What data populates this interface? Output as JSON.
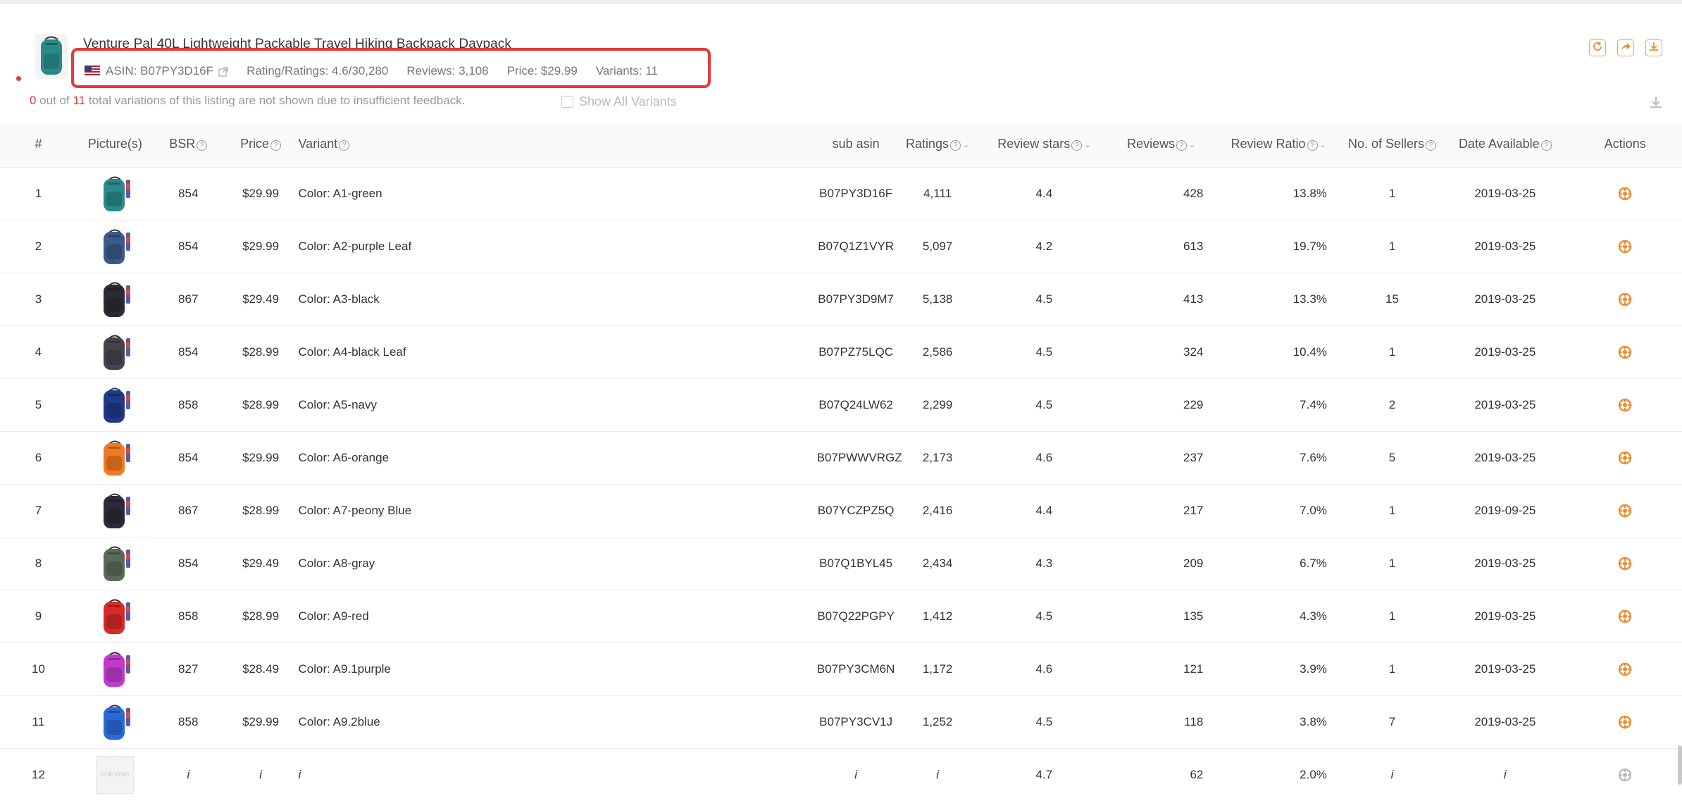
{
  "header": {
    "title": "Venture Pal 40L Lightweight Packable Travel Hiking Backpack Daypack",
    "asin_label": "ASIN: B07PY3D16F",
    "rating_label": "Rating/Ratings: 4.6/30,280",
    "reviews_label": "Reviews: 3,108",
    "price_label": "Price: $29.99",
    "variants_label": "Variants: 11",
    "flag_icon": "us-flag-icon",
    "thumb_color": "#2a8a8a"
  },
  "notice": {
    "hidden_count": "0",
    "text_1": " out of ",
    "total": "11",
    "text_2": " total variations of this listing are not shown due to insufficient feedback.",
    "show_all_label": "Show All Variants"
  },
  "toolbar": {
    "refresh_icon": "refresh-icon",
    "share_icon": "share-icon",
    "download_icon": "download-icon",
    "accent_color": "#f08c2c"
  },
  "table": {
    "columns": {
      "index": "#",
      "pictures": "Picture(s)",
      "bsr": "BSR",
      "price": "Price",
      "variant": "Variant",
      "sub_asin": "sub asin",
      "ratings": "Ratings",
      "review_stars": "Review stars",
      "reviews": "Reviews",
      "review_ratio": "Review Ratio",
      "sellers": "No. of Sellers",
      "date_available": "Date Available",
      "actions": "Actions"
    },
    "rows": [
      {
        "index": "1",
        "bsr": "854",
        "price": "$29.99",
        "variant": "Color: A1-green",
        "sub_asin": "B07PY3D16F",
        "ratings": "4,111",
        "stars": "4.4",
        "reviews": "428",
        "ratio": "13.8%",
        "sellers": "1",
        "date": "2019-03-25",
        "color": "#2a8a8a"
      },
      {
        "index": "2",
        "bsr": "854",
        "price": "$29.99",
        "variant": "Color: A2-purple Leaf",
        "sub_asin": "B07Q1Z1VYR",
        "ratings": "5,097",
        "stars": "4.2",
        "reviews": "613",
        "ratio": "19.7%",
        "sellers": "1",
        "date": "2019-03-25",
        "color": "#3a5a8a"
      },
      {
        "index": "3",
        "bsr": "867",
        "price": "$29.49",
        "variant": "Color: A3-black",
        "sub_asin": "B07PY3D9M7",
        "ratings": "5,138",
        "stars": "4.5",
        "reviews": "413",
        "ratio": "13.3%",
        "sellers": "15",
        "date": "2019-03-25",
        "color": "#2b2b33"
      },
      {
        "index": "4",
        "bsr": "854",
        "price": "$28.99",
        "variant": "Color: A4-black Leaf",
        "sub_asin": "B07PZ75LQC",
        "ratings": "2,586",
        "stars": "4.5",
        "reviews": "324",
        "ratio": "10.4%",
        "sellers": "1",
        "date": "2019-03-25",
        "color": "#44444c"
      },
      {
        "index": "5",
        "bsr": "858",
        "price": "$28.99",
        "variant": "Color: A5-navy",
        "sub_asin": "B07Q24LW62",
        "ratings": "2,299",
        "stars": "4.5",
        "reviews": "229",
        "ratio": "7.4%",
        "sellers": "2",
        "date": "2019-03-25",
        "color": "#1f3a8a"
      },
      {
        "index": "6",
        "bsr": "854",
        "price": "$29.99",
        "variant": "Color: A6-orange",
        "sub_asin": "B07PWWVRGZ",
        "ratings": "2,173",
        "stars": "4.6",
        "reviews": "237",
        "ratio": "7.6%",
        "sellers": "5",
        "date": "2019-03-25",
        "color": "#f07a20"
      },
      {
        "index": "7",
        "bsr": "867",
        "price": "$28.99",
        "variant": "Color: A7-peony Blue",
        "sub_asin": "B07YCZPZ5Q",
        "ratings": "2,416",
        "stars": "4.4",
        "reviews": "217",
        "ratio": "7.0%",
        "sellers": "1",
        "date": "2019-09-25",
        "color": "#2a2a3a"
      },
      {
        "index": "8",
        "bsr": "854",
        "price": "$29.49",
        "variant": "Color: A8-gray",
        "sub_asin": "B07Q1BYL45",
        "ratings": "2,434",
        "stars": "4.3",
        "reviews": "209",
        "ratio": "6.7%",
        "sellers": "1",
        "date": "2019-03-25",
        "color": "#5a6a58"
      },
      {
        "index": "9",
        "bsr": "858",
        "price": "$28.99",
        "variant": "Color: A9-red",
        "sub_asin": "B07Q22PGPY",
        "ratings": "1,412",
        "stars": "4.5",
        "reviews": "135",
        "ratio": "4.3%",
        "sellers": "1",
        "date": "2019-03-25",
        "color": "#d82a2a"
      },
      {
        "index": "10",
        "bsr": "827",
        "price": "$28.49",
        "variant": "Color: A9.1purple",
        "sub_asin": "B07PY3CM6N",
        "ratings": "1,172",
        "stars": "4.6",
        "reviews": "121",
        "ratio": "3.9%",
        "sellers": "1",
        "date": "2019-03-25",
        "color": "#c03acc"
      },
      {
        "index": "11",
        "bsr": "858",
        "price": "$29.99",
        "variant": "Color: A9.2blue",
        "sub_asin": "B07PY3CV1J",
        "ratings": "1,252",
        "stars": "4.5",
        "reviews": "118",
        "ratio": "3.8%",
        "sellers": "7",
        "date": "2019-03-25",
        "color": "#2a6ad8"
      }
    ],
    "unknown_row": {
      "index": "12",
      "image_label": "unknown",
      "placeholder": "i",
      "stars": "4.7",
      "reviews": "62",
      "ratio": "2.0%"
    },
    "action_icon": "target-icon"
  }
}
